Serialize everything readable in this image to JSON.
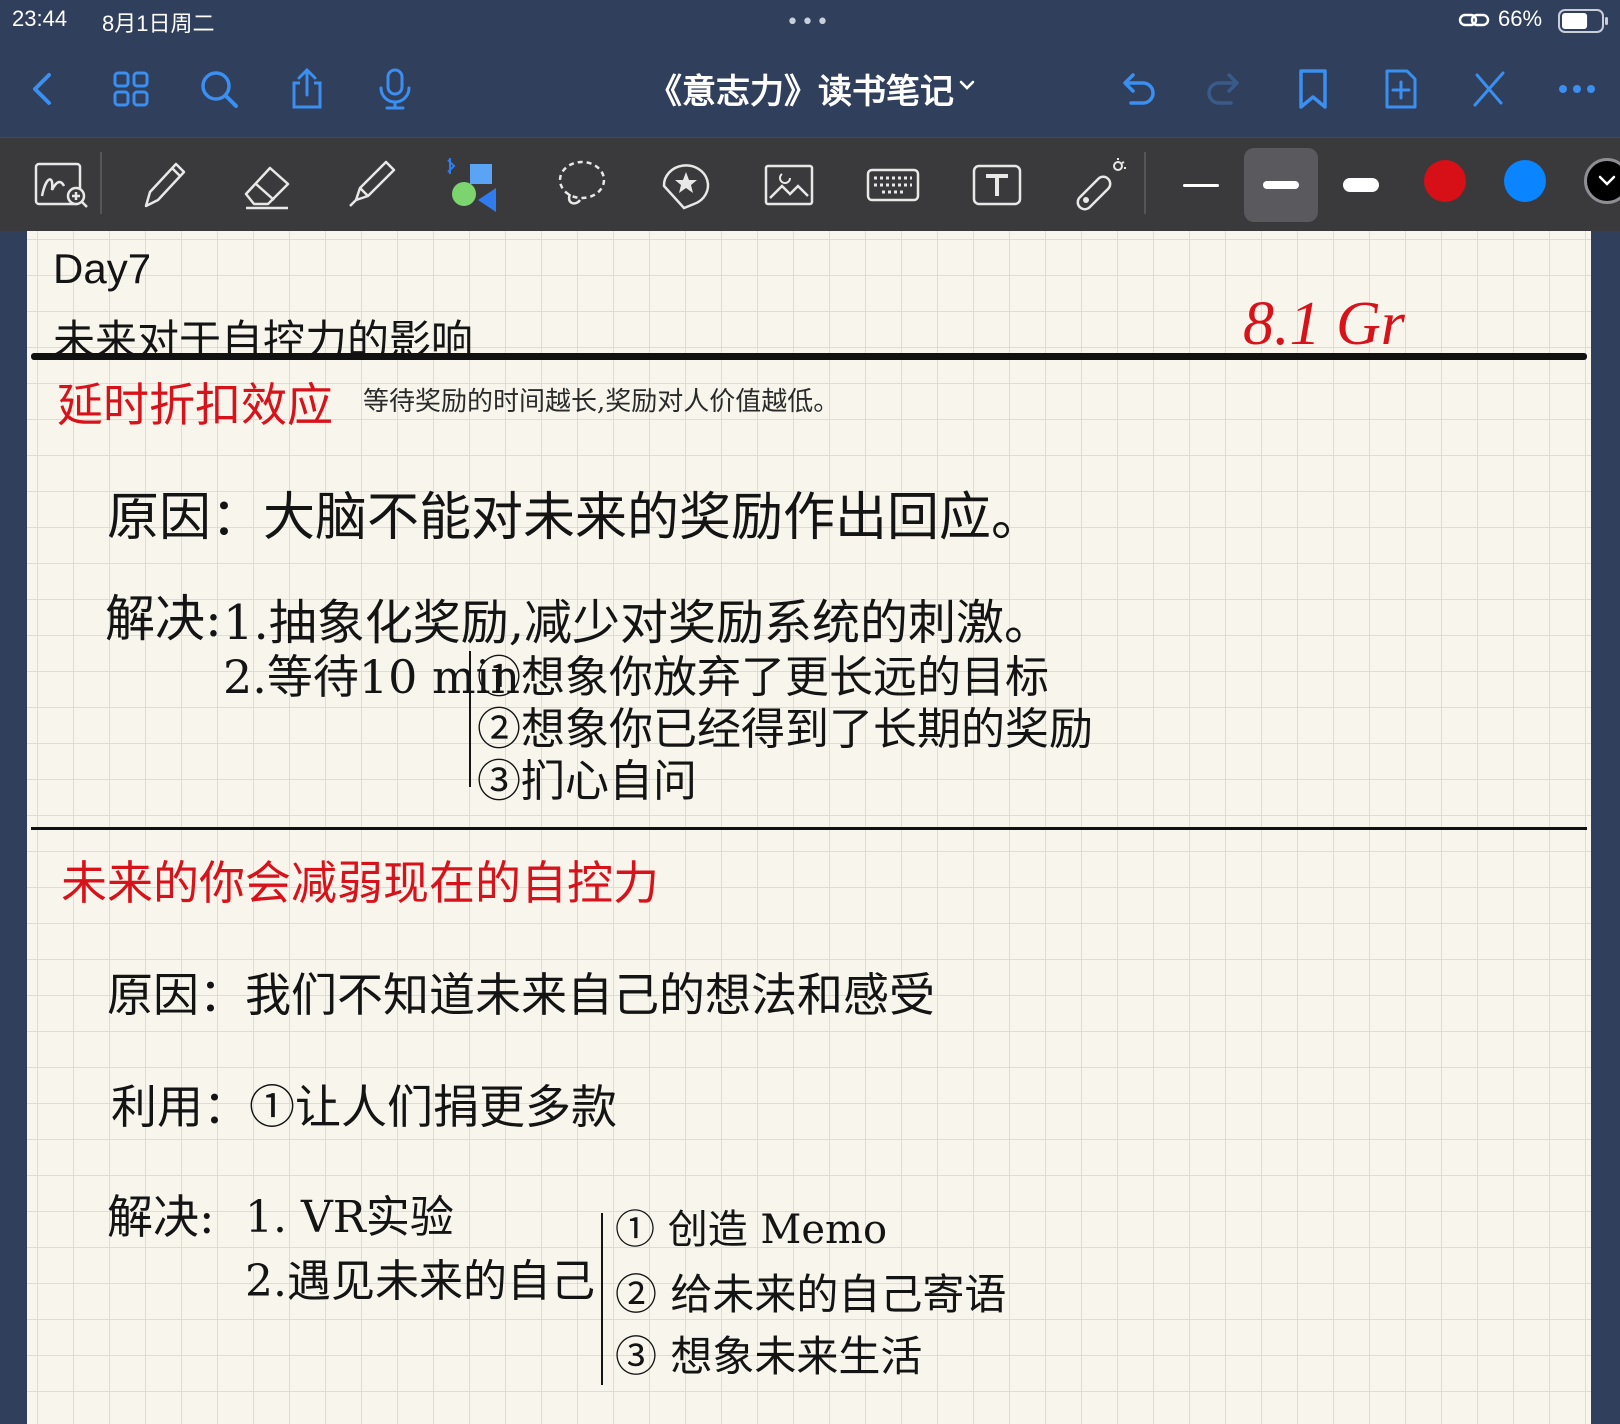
{
  "status": {
    "time": "23:44",
    "date": "8月1日周二",
    "battery": "66%",
    "battery_level": 0.66
  },
  "nav": {
    "title": "《意志力》读书笔记",
    "icons": [
      "back-icon",
      "grid-icon",
      "search-icon",
      "share-icon",
      "microphone-icon",
      "undo-icon",
      "redo-icon",
      "bookmark-icon",
      "add-page-icon",
      "close-toolbar-icon",
      "more-icon"
    ]
  },
  "tools": {
    "items": [
      "lasso-zoom-icon",
      "pen-icon",
      "eraser-icon",
      "highlighter-icon",
      "shapes-icon",
      "lasso-icon",
      "sticker-icon",
      "image-icon",
      "keyboard-icon",
      "textbox-icon",
      "laser-pointer-icon"
    ],
    "colors": {
      "red": "#d70f16",
      "blue": "#0a84ff",
      "black": "#000000"
    }
  },
  "note": {
    "day": "Day7",
    "title": "未来对于自控力的影响",
    "date_mark": "8.1  Gr",
    "section1": {
      "heading": "延时折扣效应",
      "definition": "等待奖励的时间越长,奖励对人价值越低。",
      "reason": "原因：大脑不能对未来的奖励作出回应。",
      "solution_label": "解决:",
      "solution1": "1.抽象化奖励,减少对奖励系统的刺激。",
      "solution2": "2.等待10 min",
      "sub1": "①想象你放弃了更长远的目标",
      "sub2": "②想象你已经得到了长期的奖励",
      "sub3": "③扪心自问"
    },
    "section2": {
      "heading": "未来的你会减弱现在的自控力",
      "reason": "原因：我们不知道未来自己的想法和感受",
      "use": "利用：①让人们捐更多款",
      "solution_label": "解决:",
      "solution1": "1. VR实验",
      "solution2": "2.遇见未来的自己",
      "sub1": "① 创造 Memo",
      "sub2": "② 给未来的自己寄语",
      "sub3": "③ 想象未来生活"
    }
  }
}
